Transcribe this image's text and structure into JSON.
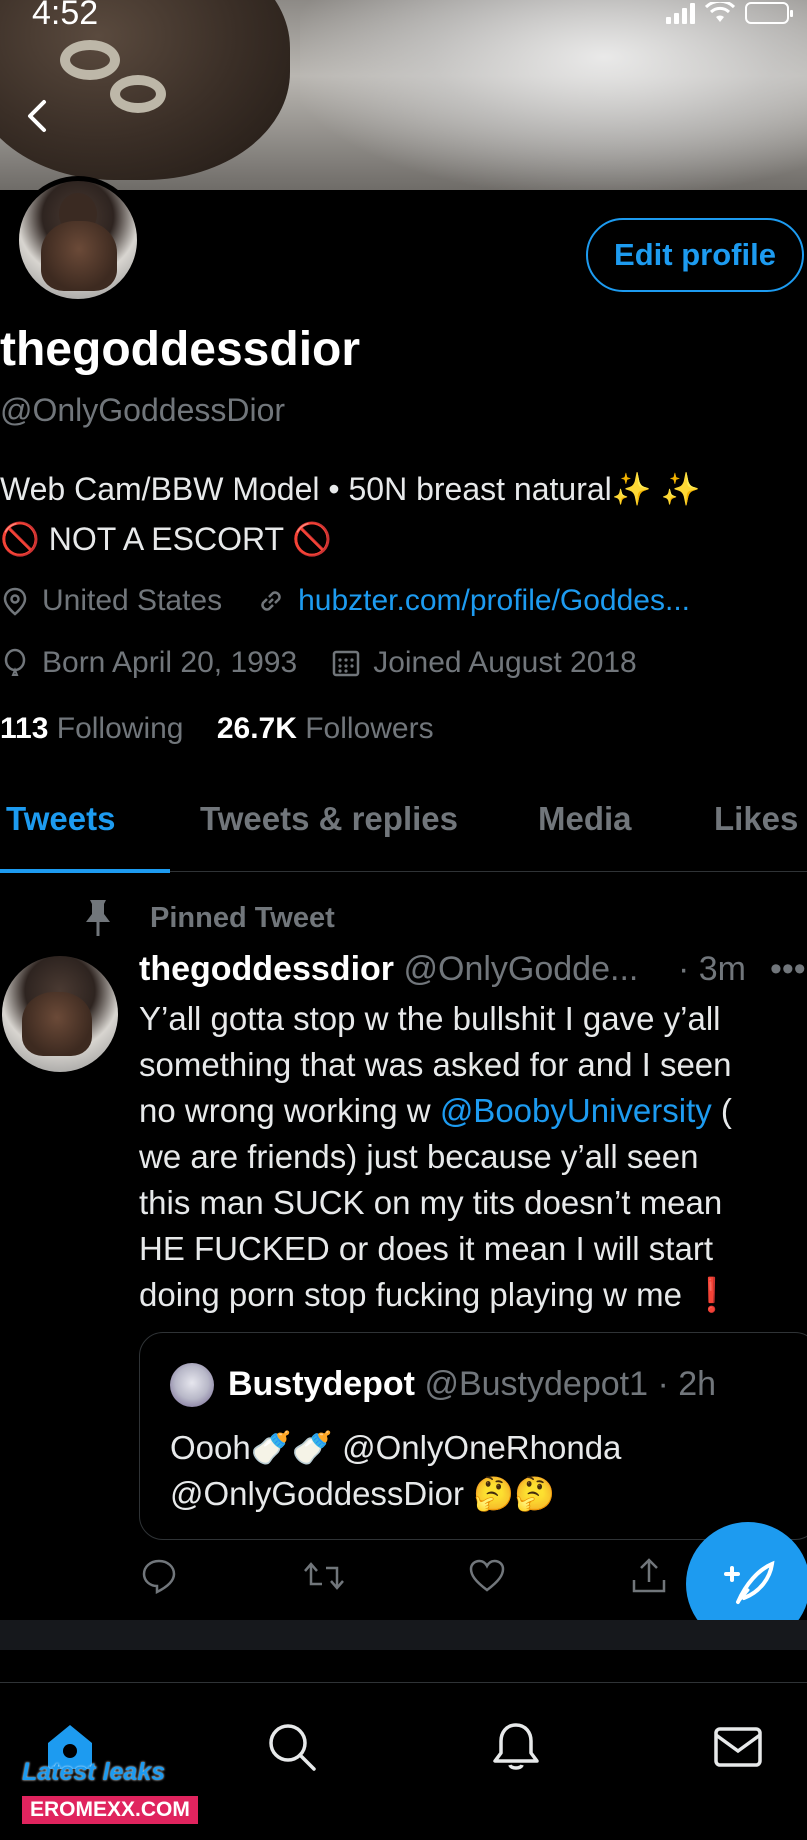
{
  "status_bar": {
    "time": "4:52"
  },
  "profile": {
    "display_name": "thegoddessdior",
    "handle": "@OnlyGoddessDior",
    "edit_profile_label": "Edit profile",
    "bio_line1": "Web Cam/BBW Model • 50N breast natural✨ ✨",
    "bio_line2": "🚫 NOT A ESCORT 🚫",
    "location": "United States",
    "website": "hubzter.com/profile/Goddes...",
    "birthday": "Born April 20, 1993",
    "joined": "Joined August 2018",
    "following_count": "113",
    "following_label": "Following",
    "followers_count": "26.7K",
    "followers_label": "Followers"
  },
  "tabs": [
    {
      "label": "Tweets",
      "active": true
    },
    {
      "label": "Tweets & replies",
      "active": false
    },
    {
      "label": "Media",
      "active": false
    },
    {
      "label": "Likes",
      "active": false
    }
  ],
  "pinned_tweet": {
    "pinned_label": "Pinned Tweet",
    "author_name": "thegoddessdior",
    "author_handle": "@OnlyGodde...",
    "time": "· 3m",
    "more": "•••",
    "body_lines": [
      "Y’all gotta stop w the bullshit I gave  y’all",
      "something that was asked for and I seen",
      "no wrong working w ",
      "we are friends) just because y’all seen",
      "this man SUCK on my tits doesn’t mean",
      "HE FUCKED or does it mean I will start",
      "doing porn stop fucking playing w me ❗"
    ],
    "mention": "@BoobyUniversity",
    "after_mention": "  (",
    "quote": {
      "author_name": "Bustydepot",
      "author_handle": "@Bustydepot1",
      "time": "· 2h",
      "line1": "Oooh🍼🍼 @OnlyOneRhonda",
      "line2": "@OnlyGoddessDior 🤔🤔"
    }
  },
  "watermark": {
    "line1": "Latest leaks",
    "line2": "EROMEXX.COM"
  },
  "icons": {
    "back": "chevron-left-icon",
    "location": "location-pin-icon",
    "link": "link-icon",
    "birthday": "balloon-icon",
    "calendar": "calendar-icon",
    "pin": "pin-icon",
    "reply": "reply-icon",
    "retweet": "retweet-icon",
    "like": "heart-icon",
    "share": "share-icon",
    "compose": "compose-icon",
    "home": "home-icon",
    "search": "search-icon",
    "notifications": "bell-icon",
    "messages": "mail-icon"
  },
  "colors": {
    "accent": "#1d9bf0",
    "background": "#000000",
    "secondary_text": "#71767b"
  }
}
